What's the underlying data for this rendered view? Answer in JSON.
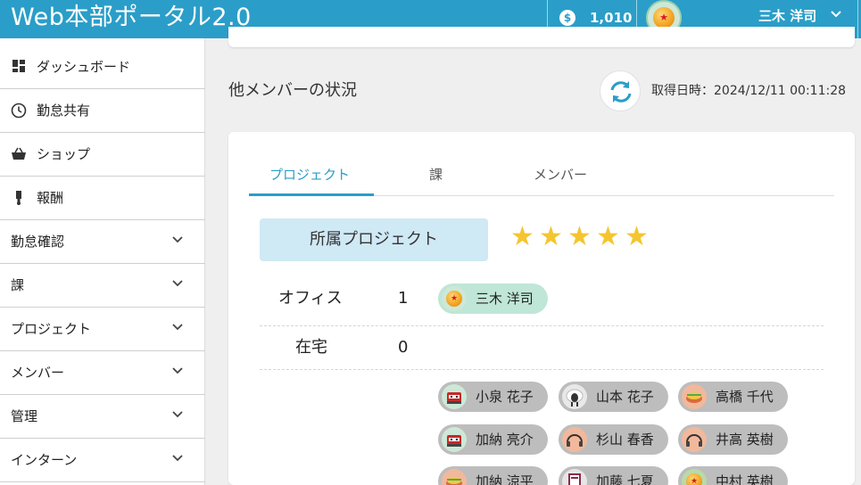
{
  "header": {
    "app_title": "Web本部ポータル2.0",
    "coin_symbol": "$",
    "points": "1,010",
    "user_name": "三木 洋司"
  },
  "sidebar": {
    "items": [
      {
        "label": "ダッシュボード",
        "icon": "dashboard-icon"
      },
      {
        "label": "勤怠共有",
        "icon": "clock-icon"
      },
      {
        "label": "ショップ",
        "icon": "basket-icon"
      },
      {
        "label": "報酬",
        "icon": "medal-icon"
      },
      {
        "label": "勤怠確認",
        "expandable": true
      },
      {
        "label": "課",
        "expandable": true
      },
      {
        "label": "プロジェクト",
        "expandable": true
      },
      {
        "label": "メンバー",
        "expandable": true
      },
      {
        "label": "管理",
        "expandable": true
      },
      {
        "label": "インターン",
        "expandable": true
      }
    ]
  },
  "main": {
    "section_title": "他メンバーの状況",
    "acquired_at": "取得日時：2024/12/11 00:11:28",
    "tabs": [
      {
        "label": "プロジェクト",
        "active": true
      },
      {
        "label": "課",
        "active": false
      },
      {
        "label": "メンバー",
        "active": false
      }
    ],
    "project_label": "所属プロジェクト",
    "rating": 5,
    "office": {
      "label": "オフィス",
      "count": "1",
      "members": [
        "三木 洋司"
      ]
    },
    "remote": {
      "label": "在宅",
      "count": "0"
    },
    "others": [
      "小泉 花子",
      "山本 花子",
      "高橋 千代",
      "加納 亮介",
      "杉山 春香",
      "井高 英樹",
      "加納 涼平",
      "加藤 七夏",
      "中村 英樹"
    ]
  },
  "colors": {
    "header_bg": "#2a9ec8",
    "accent": "#2a9ec8",
    "star": "#f5c530",
    "office_chip": "#bfe6d6",
    "other_chip": "#bdbdbd"
  }
}
